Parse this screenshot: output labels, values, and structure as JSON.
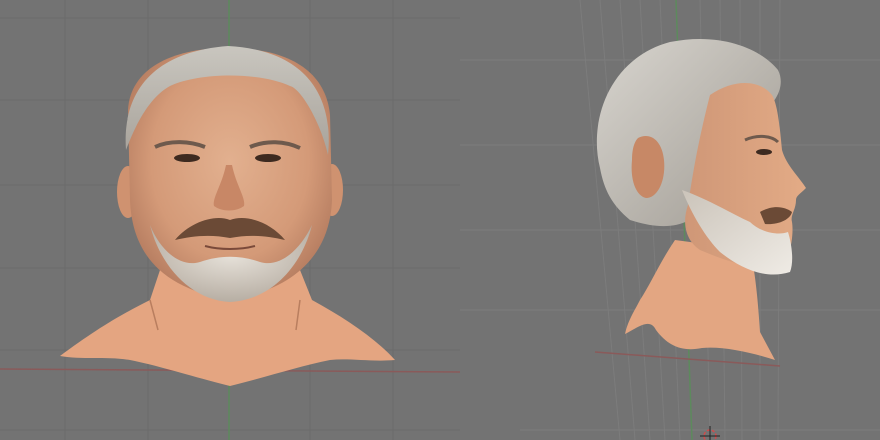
{
  "app": {
    "type": "3d-viewport-split"
  },
  "viewports": [
    {
      "view": "front",
      "model": "head-bust"
    },
    {
      "view": "right-side",
      "model": "head-bust"
    }
  ],
  "colors": {
    "background": "#737373",
    "grid": "#6b6b6b",
    "grid_light": "#7b7b7b",
    "x_axis": "#8a5a5a",
    "z_axis": "#5a8a5a",
    "skin": "#e1a07c",
    "skin_shadow": "#c88766",
    "hair": "#d3d0cb",
    "beard": "#d8d3cc",
    "moustache": "#6b4a36"
  },
  "icons": {
    "cursor": "3d-cursor-icon"
  }
}
